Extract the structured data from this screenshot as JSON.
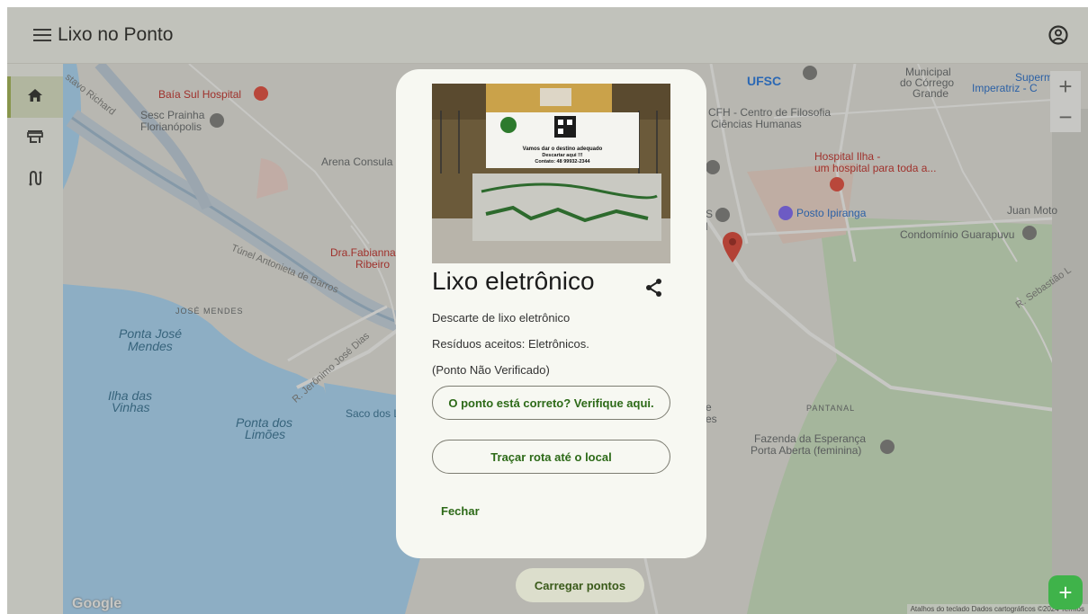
{
  "app": {
    "title": "Lixo no Ponto"
  },
  "rail": {
    "items": [
      {
        "icon": "home-icon",
        "active": true
      },
      {
        "icon": "store-icon",
        "active": false
      },
      {
        "icon": "route-icon",
        "active": false
      }
    ]
  },
  "map": {
    "labels": {
      "gustavo_richard": "stavo Richard",
      "baia_sul": "Baía Sul Hospital",
      "sesc_1": "Sesc Prainha",
      "sesc_2": "Florianópolis",
      "arena": "Arena Consula",
      "fabianna_1": "Dra.Fabianna",
      "fabianna_2": "Ribeiro",
      "tunel": "Túnel Antonieta de Barros",
      "jose_mendes_caps": "JOSÉ MENDES",
      "ponta_jose_1": "Ponta José",
      "ponta_jose_2": "Mendes",
      "jeronimo": "R. Jerônimo José Dias",
      "ilha_1": "Ilha das",
      "ilha_2": "Vinhas",
      "ponta_limoes_1": "Ponta dos",
      "ponta_limoes_2": "Limões",
      "saco": "Saco dos L",
      "ufsc": "UFSC",
      "cfh_1": "CFH - Centro de Filosofia",
      "cfh_2": "Ciências Humanas",
      "municipal_1": "Municipal",
      "municipal_2": "do Córrego",
      "municipal_3": "Grande",
      "superm_1": "Superm",
      "superm_2": "Imperatriz - C",
      "hospital_ilha_1": "Hospital Ilha -",
      "hospital_ilha_2": "um hospital para toda a...",
      "posto": "Posto Ipiranga",
      "juan": "Juan Moto",
      "condominio": "Condomínio Guarapuvu",
      "sebastiao": "R. Sebastião L",
      "pantanal": "PANTANAL",
      "fazenda_1": "Fazenda da Esperança",
      "fazenda_2": "Porta Aberta (feminina)",
      "frag_e": "e",
      "frag_es": "es",
      "frag_s": "S",
      "frag_l": "l"
    },
    "zoom_in": "+",
    "zoom_out": "−",
    "google": "Google",
    "attribution": "Atalhos do teclado   Dados cartográficos ©2024   Termos"
  },
  "dialog": {
    "photo_banner_1": "Vamos dar o destino adequado",
    "photo_banner_2": "Descartar aqui !!!",
    "photo_banner_3": "Contato: 48 99932-2344",
    "title": "Lixo eletrônico",
    "description": "Descarte de lixo eletrônico",
    "accepted": "Resíduos aceitos: Eletrônicos.",
    "status": "(Ponto Não Verificado)",
    "verify_button": "O ponto está correto? Verifique aqui.",
    "route_button": "Traçar rota até o local",
    "close_button": "Fechar"
  },
  "load_button": "Carregar pontos",
  "fab_label": "+",
  "colors": {
    "accent_green": "#2d6a18",
    "fab": "#3fb34a",
    "rail_active": "#dfe6c9",
    "surface": "#f7f8f2"
  }
}
